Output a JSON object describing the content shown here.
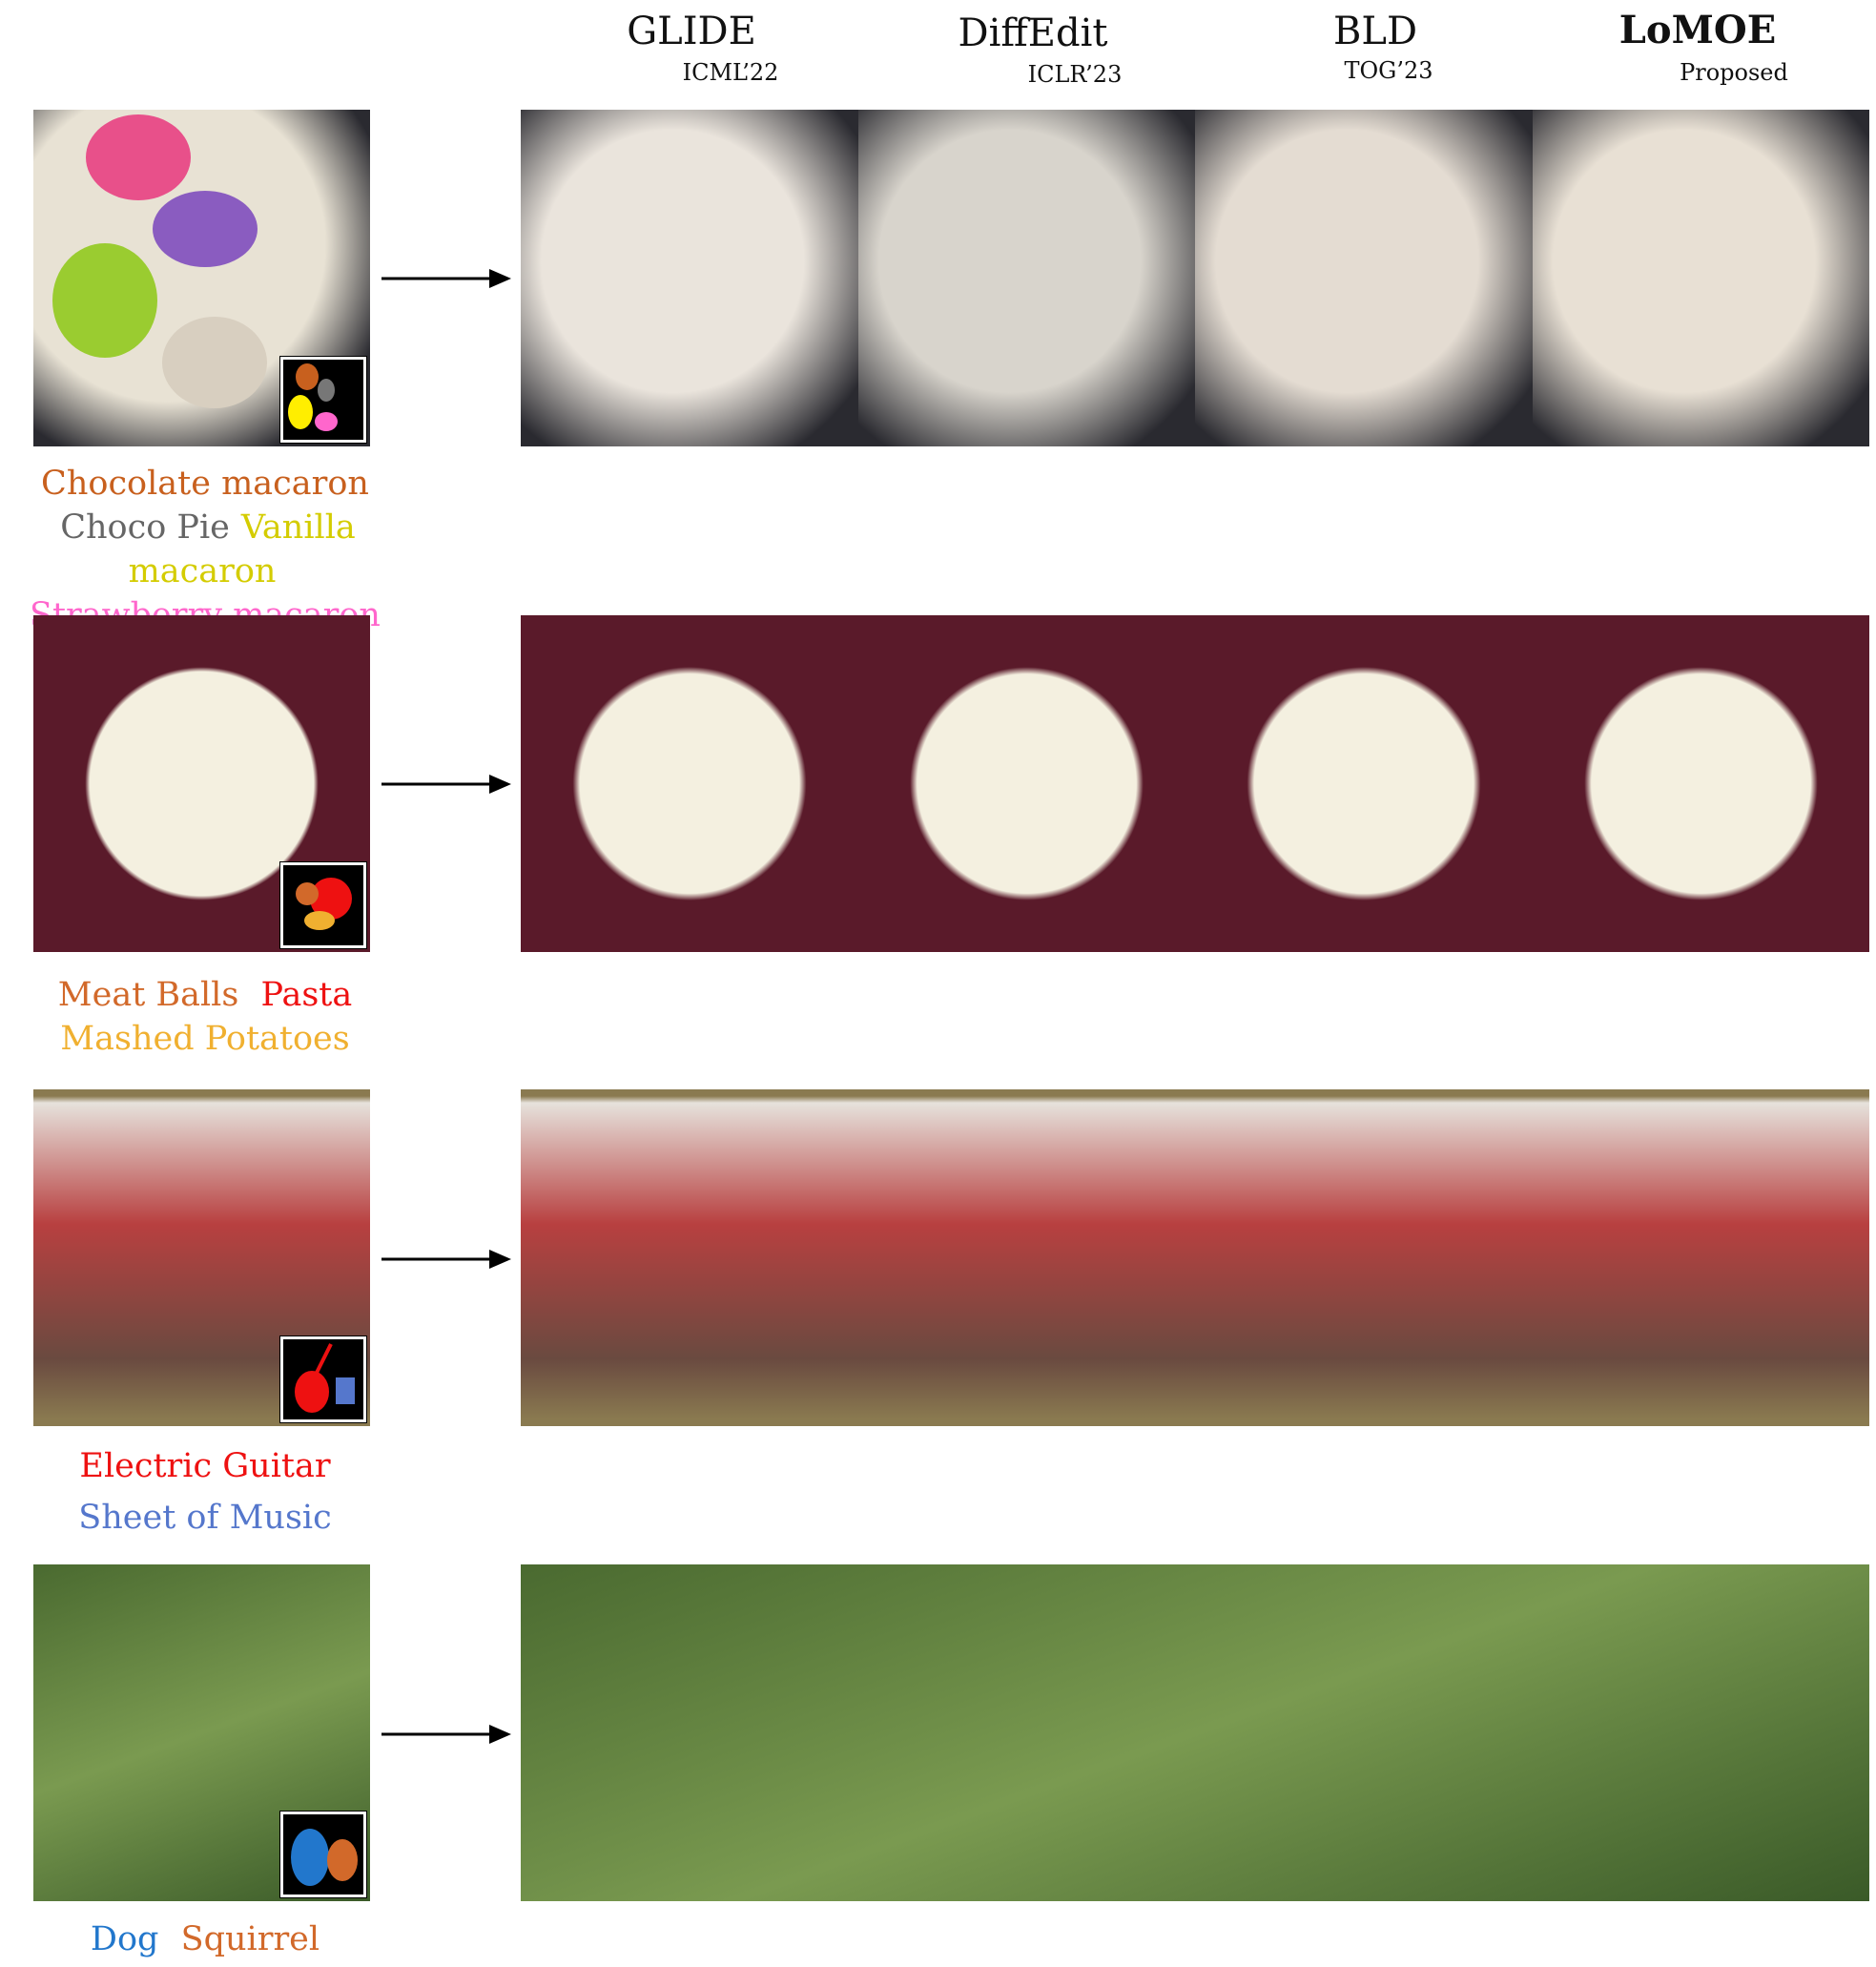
{
  "methods": [
    {
      "name": "GLIDE",
      "venue": "ICML’22"
    },
    {
      "name": "DiffEdit",
      "venue": "ICLR’23"
    },
    {
      "name": "BLD",
      "venue": "TOG’23"
    },
    {
      "name": "LoMOE",
      "venue": "Proposed"
    }
  ],
  "rows": [
    {
      "scene": "macarons",
      "labels": [
        {
          "text": "Chocolate macaron",
          "color": "#c8601e"
        },
        {
          "text": "Choco Pie",
          "color": "#666666"
        },
        {
          "text": "Vanilla macaron",
          "color": "#d4cc00"
        },
        {
          "text": "Strawberry macaron",
          "color": "#ff66cc"
        }
      ]
    },
    {
      "scene": "pasta-bowl",
      "labels": [
        {
          "text": "Meat Balls",
          "color": "#d2692a"
        },
        {
          "text": "Pasta",
          "color": "#ee1111"
        },
        {
          "text": "Mashed Potatoes",
          "color": "#f0b030"
        }
      ]
    },
    {
      "scene": "cello-painting",
      "labels": [
        {
          "text": "Electric Guitar",
          "color": "#ee1111"
        },
        {
          "text": "Sheet of Music",
          "color": "#5577cc"
        }
      ]
    },
    {
      "scene": "kitten-rabbit",
      "labels": [
        {
          "text": "Dog",
          "color": "#2277cc"
        },
        {
          "text": "Squirrel",
          "color": "#d2692a"
        }
      ]
    }
  ]
}
